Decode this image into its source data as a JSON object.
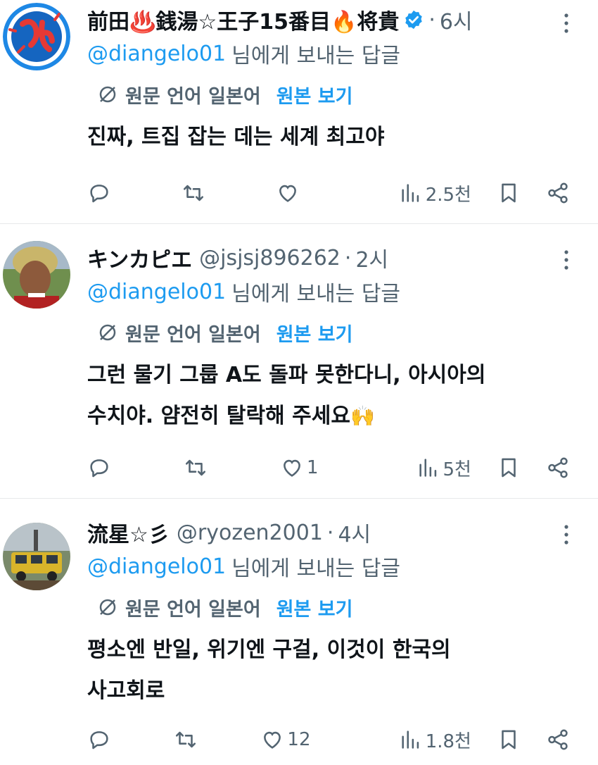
{
  "tweets": [
    {
      "name": "前田♨️銭湯☆王子15番目🔥将貴",
      "handle": "",
      "time": "6시",
      "verified": true,
      "reply_to": "@diangelo01",
      "reply_suffix": "님에게 보내는 답글",
      "translate_text": "원문 언어 일본어",
      "view_original": "원본 보기",
      "lines": [
        "진짜, 트집 잡는 데는 세계 최고야"
      ],
      "likes": "",
      "views": "2.5천"
    },
    {
      "name": "キンカピエ",
      "handle": "@jsjsj896262",
      "time": "2시",
      "verified": false,
      "reply_to": "@diangelo01",
      "reply_suffix": "님에게 보내는 답글",
      "translate_text": "원문 언어 일본어",
      "view_original": "원본 보기",
      "lines": [
        "그런 물기 그룹 A도 돌파 못한다니, 아시아의",
        "수치야. 얌전히 탈락해 주세요"
      ],
      "emoji": "🙌",
      "likes": "1",
      "views": "5천"
    },
    {
      "name": "流星☆彡",
      "handle": "@ryozen2001",
      "time": "4시",
      "verified": false,
      "reply_to": "@diangelo01",
      "reply_suffix": "님에게 보내는 답글",
      "translate_text": "원문 언어 일본어",
      "view_original": "원본 보기",
      "lines": [
        "평소엔 반일, 위기엔 구걸, 이것이 한국의",
        "사고회로"
      ],
      "likes": "12",
      "views": "1.8천"
    }
  ],
  "colors": {
    "text": "#0f1419",
    "secondary": "#536471",
    "link": "#1d9bf0",
    "divider": "#e7e9ea",
    "avatar0_bg": "#1e88e5",
    "avatar0_glyph": "#e53935"
  },
  "icons": [
    "verified-badge-icon",
    "more-icon",
    "globe-translate-icon",
    "reply-icon",
    "retweet-icon",
    "like-icon",
    "views-icon",
    "bookmark-icon",
    "share-icon"
  ]
}
